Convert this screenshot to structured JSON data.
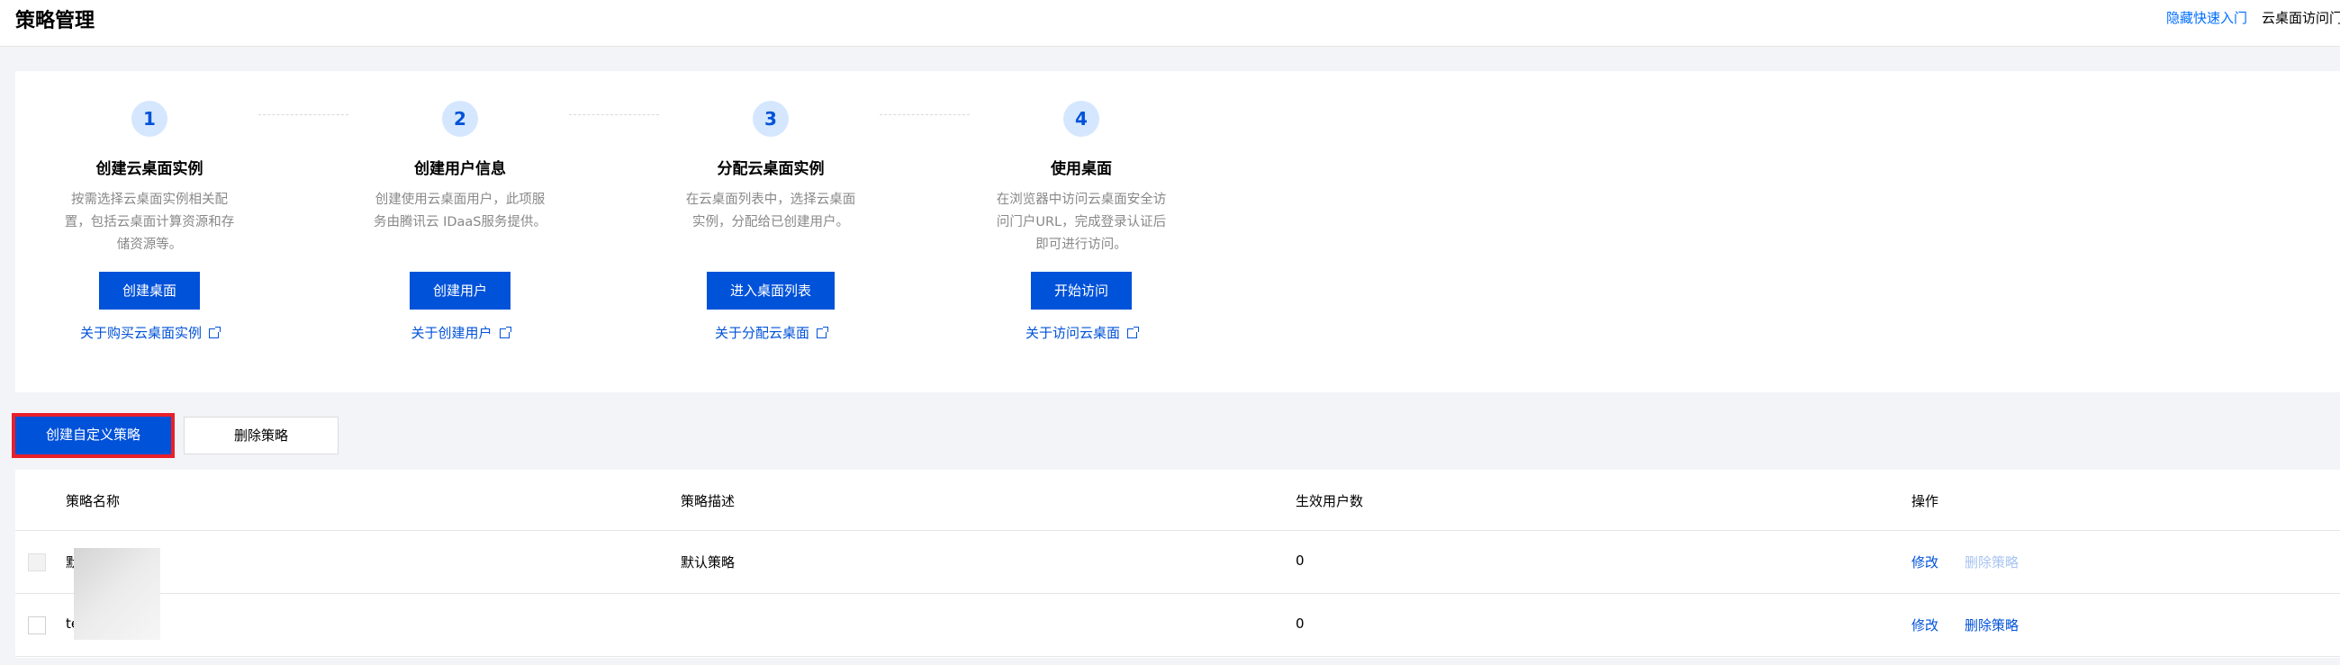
{
  "header": {
    "title": "策略管理",
    "hide_quick_entry": "隐藏快速入门",
    "extra_text": "云桌面访问门户"
  },
  "guide": {
    "steps": [
      {
        "number": "1",
        "title": "创建云桌面实例",
        "desc": "按需选择云桌面实例相关配置，包括云桌面计算资源和存储资源等。",
        "button": "创建桌面",
        "link": "关于购买云桌面实例"
      },
      {
        "number": "2",
        "title": "创建用户信息",
        "desc": "创建使用云桌面用户，此项服务由腾讯云 IDaaS服务提供。",
        "button": "创建用户",
        "link": "关于创建用户"
      },
      {
        "number": "3",
        "title": "分配云桌面实例",
        "desc": "在云桌面列表中，选择云桌面实例，分配给已创建用户。",
        "button": "进入桌面列表",
        "link": "关于分配云桌面"
      },
      {
        "number": "4",
        "title": "使用桌面",
        "desc": "在浏览器中访问云桌面安全访问门户URL，完成登录认证后即可进行访问。",
        "button": "开始访问",
        "link": "关于访问云桌面"
      }
    ]
  },
  "toolbar": {
    "create_label": "创建自定义策略",
    "delete_label": "删除策略"
  },
  "table": {
    "columns": [
      "策略名称",
      "策略描述",
      "生效用户数",
      "操作"
    ],
    "rows": [
      {
        "name": "默",
        "desc": "默认策略",
        "users": "0",
        "edit": "修改",
        "delete": "删除策略",
        "delete_enabled": false,
        "selectable": false
      },
      {
        "name": "te",
        "desc": "",
        "users": "0",
        "edit": "修改",
        "delete": "删除策略",
        "delete_enabled": true,
        "selectable": true
      }
    ]
  },
  "colors": {
    "primary": "#0052d9",
    "highlight": "#e8202a",
    "step_circle_bg": "#d5e7ff",
    "disabled_link": "#a8c4f0"
  }
}
